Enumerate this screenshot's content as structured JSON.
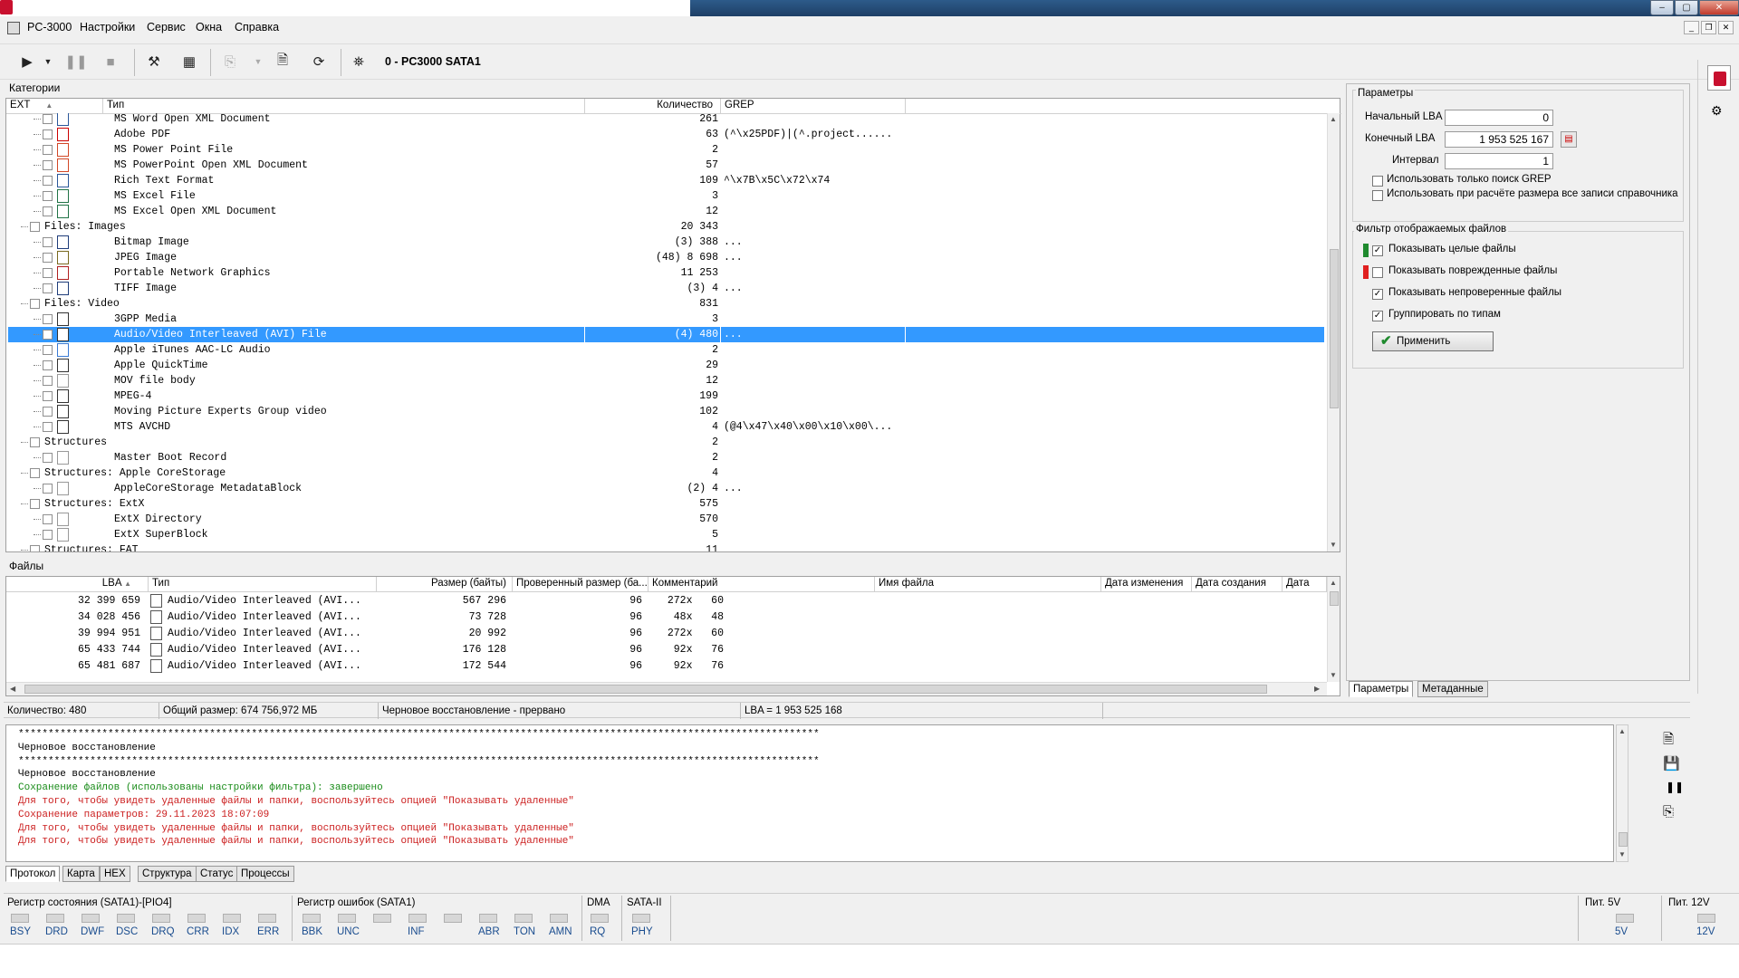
{
  "app": {
    "title": "PC-3000"
  },
  "menu": [
    "PC-3000",
    "Настройки",
    "Сервис",
    "Окна",
    "Справка"
  ],
  "toolbar": {
    "device_label": "0 - PC3000 SATA1"
  },
  "categories": {
    "title": "Категории",
    "columns": {
      "ext": "EXT",
      "type": "Тип",
      "count": "Количество",
      "grep": "GREP"
    },
    "rows": [
      {
        "indent": 2,
        "icon": "doc-icon",
        "name": "MS Word Open XML Document",
        "count": "261",
        "grep": ""
      },
      {
        "indent": 2,
        "icon": "pdf-icon",
        "name": "Adobe PDF",
        "count": "63",
        "grep": "(^\\x25PDF)|(^.project......"
      },
      {
        "indent": 2,
        "icon": "ppt-icon",
        "name": "MS Power Point File",
        "count": "2",
        "grep": ""
      },
      {
        "indent": 2,
        "icon": "ppt-icon",
        "name": "MS PowerPoint Open XML Document",
        "count": "57",
        "grep": ""
      },
      {
        "indent": 2,
        "icon": "rtf-icon",
        "name": "Rich Text Format",
        "count": "109",
        "grep": "^\\x7B\\x5C\\x72\\x74"
      },
      {
        "indent": 2,
        "icon": "xls-icon",
        "name": "MS Excel File",
        "count": "3",
        "grep": ""
      },
      {
        "indent": 2,
        "icon": "xls-icon",
        "name": "MS Excel Open XML Document",
        "count": "12",
        "grep": ""
      },
      {
        "indent": 1,
        "icon": "",
        "name": "Files: Images",
        "count": "20 343",
        "grep": ""
      },
      {
        "indent": 2,
        "icon": "bmp-icon",
        "name": "Bitmap Image",
        "count": "(3) 388",
        "grep": "..."
      },
      {
        "indent": 2,
        "icon": "jpg-icon",
        "name": "JPEG Image",
        "count": "(48) 8 698",
        "grep": "..."
      },
      {
        "indent": 2,
        "icon": "png-icon",
        "name": "Portable Network Graphics",
        "count": "11 253",
        "grep": ""
      },
      {
        "indent": 2,
        "icon": "tif-icon",
        "name": "TIFF Image",
        "count": "(3) 4",
        "grep": "..."
      },
      {
        "indent": 1,
        "icon": "",
        "name": "Files: Video",
        "count": "831",
        "grep": ""
      },
      {
        "indent": 2,
        "icon": "video-icon",
        "name": "3GPP Media",
        "count": "3",
        "grep": ""
      },
      {
        "indent": 2,
        "icon": "video-icon",
        "name": "Audio/Video Interleaved (AVI) File",
        "count": "(4) 480",
        "grep": "...",
        "selected": true
      },
      {
        "indent": 2,
        "icon": "audio-icon",
        "name": "Apple iTunes AAC-LC Audio",
        "count": "2",
        "grep": ""
      },
      {
        "indent": 2,
        "icon": "video-icon",
        "name": "Apple QuickTime",
        "count": "29",
        "grep": ""
      },
      {
        "indent": 2,
        "icon": "blank-icon",
        "name": "MOV file body",
        "count": "12",
        "grep": ""
      },
      {
        "indent": 2,
        "icon": "video-icon",
        "name": "MPEG-4",
        "count": "199",
        "grep": ""
      },
      {
        "indent": 2,
        "icon": "video-icon",
        "name": "Moving Picture Experts Group video",
        "count": "102",
        "grep": ""
      },
      {
        "indent": 2,
        "icon": "video-icon",
        "name": "MTS AVCHD",
        "count": "4",
        "grep": "(@4\\x47\\x40\\x00\\x10\\x00\\..."
      },
      {
        "indent": 1,
        "icon": "",
        "name": "Structures",
        "count": "2",
        "grep": ""
      },
      {
        "indent": 2,
        "icon": "blank-icon",
        "name": "Master Boot Record",
        "count": "2",
        "grep": ""
      },
      {
        "indent": 1,
        "icon": "",
        "name": "Structures: Apple CoreStorage",
        "count": "4",
        "grep": ""
      },
      {
        "indent": 2,
        "icon": "blank-icon",
        "name": "AppleCoreStorage MetadataBlock",
        "count": "(2) 4",
        "grep": "..."
      },
      {
        "indent": 1,
        "icon": "",
        "name": "Structures: ExtX",
        "count": "575",
        "grep": ""
      },
      {
        "indent": 2,
        "icon": "blank-icon",
        "name": "ExtX Directory",
        "count": "570",
        "grep": ""
      },
      {
        "indent": 2,
        "icon": "blank-icon",
        "name": "ExtX SuperBlock",
        "count": "5",
        "grep": ""
      },
      {
        "indent": 1,
        "icon": "",
        "name": "Structures: FAT",
        "count": "11",
        "grep": ""
      }
    ]
  },
  "files": {
    "title": "Файлы",
    "columns": {
      "lba": "LBA",
      "type": "Тип",
      "size": "Размер (байты)",
      "checked": "Проверенный размер (ба...",
      "comment": "Комментарий",
      "filename": "Имя файла",
      "modified": "Дата изменения",
      "created": "Дата создания",
      "accessed": "Дата дос"
    },
    "rows": [
      {
        "lba": "32 399 659",
        "type": "Audio/Video Interleaved (AVI...",
        "size": "567 296",
        "checked": "96",
        "comment": "272x   60"
      },
      {
        "lba": "34 028 456",
        "type": "Audio/Video Interleaved (AVI...",
        "size": "73 728",
        "checked": "96",
        "comment": "48x   48"
      },
      {
        "lba": "39 994 951",
        "type": "Audio/Video Interleaved (AVI...",
        "size": "20 992",
        "checked": "96",
        "comment": "272x   60"
      },
      {
        "lba": "65 433 744",
        "type": "Audio/Video Interleaved (AVI...",
        "size": "176 128",
        "checked": "96",
        "comment": "92x   76"
      },
      {
        "lba": "65 481 687",
        "type": "Audio/Video Interleaved (AVI...",
        "size": "172 544",
        "checked": "96",
        "comment": "92x   76"
      }
    ]
  },
  "status": {
    "count": "Количество: 480",
    "total_size": "Общий размер: 674 756,972 МБ",
    "state": "Черновое восстановление - прервано",
    "lba": "LBA =   1 953 525 168"
  },
  "log": {
    "lines": [
      {
        "text": "**************************************************************************************************************************************",
        "color": "#000"
      },
      {
        "text": "Черновое восстановление",
        "color": "#000"
      },
      {
        "text": "**************************************************************************************************************************************",
        "color": "#000"
      },
      {
        "text": "Черновое восстановление",
        "color": "#000"
      },
      {
        "text": "Сохранение файлов (использованы настройки фильтра): завершено",
        "color": "#1a8c1a"
      },
      {
        "text": "Для того, чтобы увидеть удаленные файлы и папки, воспользуйтесь опцией \"Показывать удаленные\"",
        "color": "#cc2020"
      },
      {
        "text": "Сохранение параметров: 29.11.2023 18:07:09",
        "color": "#cc2020"
      },
      {
        "text": "Для того, чтобы увидеть удаленные файлы и папки, воспользуйтесь опцией \"Показывать удаленные\"",
        "color": "#cc2020"
      },
      {
        "text": "Для того, чтобы увидеть удаленные файлы и папки, воспользуйтесь опцией \"Показывать удаленные\"",
        "color": "#cc2020"
      }
    ],
    "tabs": [
      "Протокол",
      "Карта",
      "HEX",
      "Структура",
      "Статус",
      "Процессы"
    ]
  },
  "params": {
    "group_title": "Параметры",
    "start_lba_label": "Начальный LBA",
    "start_lba": "0",
    "end_lba_label": "Конечный  LBA",
    "end_lba": "1 953 525 167",
    "interval_label": "Интервал",
    "interval": "1",
    "grep_only": "Использовать только поиск GREP",
    "use_all_records": "Использовать при расчёте размера все записи справочника",
    "filter_title": "Фильтр отображаемых файлов",
    "show_whole": "Показывать целые файлы",
    "show_damaged": "Показывать поврежденные файлы",
    "show_unchecked": "Показывать непроверенные файлы",
    "group_by_type": "Группировать по типам",
    "apply": "Применить",
    "tabs": [
      "Параметры",
      "Метаданные"
    ],
    "colors": {
      "whole": "#1f8a2e",
      "damaged": "#e02020"
    }
  },
  "registers": {
    "state_title": "Регистр состояния (SATA1)-[PIO4]",
    "state_leds": [
      "BSY",
      "DRD",
      "DWF",
      "DSC",
      "DRQ",
      "CRR",
      "IDX",
      "ERR"
    ],
    "error_title": "Регистр ошибок (SATA1)",
    "error_leds": [
      "BBK",
      "UNC",
      "",
      "INF",
      "",
      "ABR",
      "TON",
      "AMN"
    ],
    "dma_title": "DMA",
    "dma_leds": [
      "RQ"
    ],
    "sata_title": "SATA-II",
    "sata_leds": [
      "PHY"
    ],
    "p5_title": "Пит. 5V",
    "p5_leds": [
      "5V"
    ],
    "p12_title": "Пит. 12V",
    "p12_leds": [
      "12V"
    ]
  }
}
